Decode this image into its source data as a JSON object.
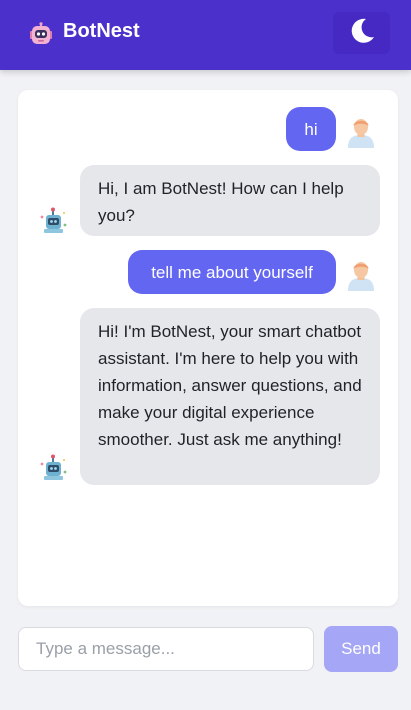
{
  "header": {
    "title": "BotNest",
    "brand_icon": "robot-icon",
    "theme_toggle_icon": "moon-icon"
  },
  "messages": [
    {
      "sender": "user",
      "text": "hi",
      "avatar": "user-avatar-icon"
    },
    {
      "sender": "bot",
      "text": "Hi, I am BotNest! How can I help you?",
      "avatar": "bot-avatar-icon"
    },
    {
      "sender": "user",
      "text": "tell me about yourself",
      "avatar": "user-avatar-icon"
    },
    {
      "sender": "bot",
      "text": "Hi! I'm BotNest, your smart chatbot assistant. I'm here to help you with information, answer questions, and make your digital experience smoother. Just ask me anything!",
      "avatar": "bot-avatar-icon"
    }
  ],
  "composer": {
    "placeholder": "Type a message...",
    "value": "",
    "send_label": "Send"
  },
  "colors": {
    "header": "#4b30cc",
    "user_bubble": "#6366f1",
    "bot_bubble": "#e5e7eb",
    "send_button": "#a5a6f6"
  }
}
